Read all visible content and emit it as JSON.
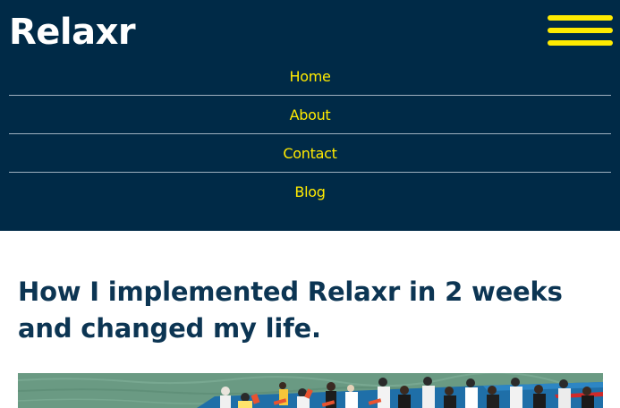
{
  "header": {
    "logo_text": "Relaxr",
    "menu_icon": "hamburger-menu-icon",
    "background_color": "#002a47",
    "accent_color": "#ffea00"
  },
  "nav": {
    "items": [
      {
        "label": "Home"
      },
      {
        "label": "About"
      },
      {
        "label": "Contact"
      },
      {
        "label": "Blog"
      }
    ]
  },
  "article": {
    "title": "How I implemented Relaxr in 2 weeks and changed my life.",
    "title_color": "#0c3553",
    "image": "dragon-boat-race-photo"
  }
}
